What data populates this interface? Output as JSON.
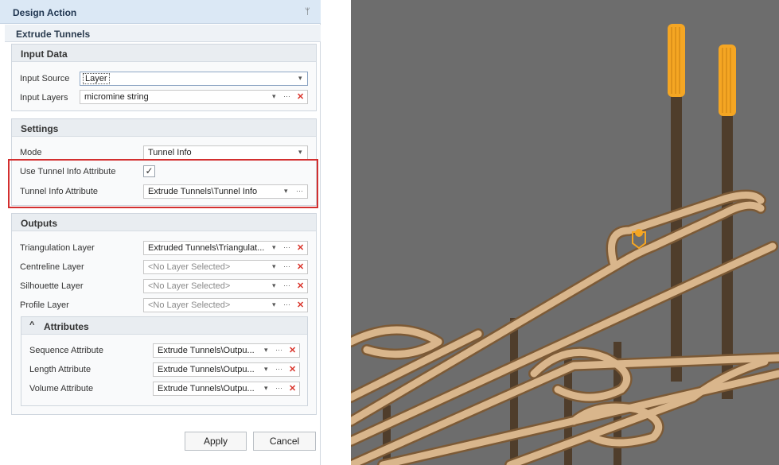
{
  "panel": {
    "title": "Design Action",
    "pin": "ᛘ",
    "subtitle": "Extrude Tunnels",
    "input_data": {
      "header": "Input Data",
      "input_source_label": "Input Source",
      "input_source_value": "Layer",
      "input_layers_label": "Input Layers",
      "input_layers_value": "micromine string"
    },
    "settings": {
      "header": "Settings",
      "mode_label": "Mode",
      "mode_value": "Tunnel Info",
      "use_attr_label": "Use Tunnel Info Attribute",
      "use_attr_checked": "✓",
      "attr_label": "Tunnel Info Attribute",
      "attr_value": "Extrude Tunnels\\Tunnel Info"
    },
    "outputs": {
      "header": "Outputs",
      "triangulation_label": "Triangulation Layer",
      "triangulation_value": "Extruded Tunnels\\Triangulat...",
      "centreline_label": "Centreline Layer",
      "centreline_value": "<No Layer Selected>",
      "silhouette_label": "Silhouette Layer",
      "silhouette_value": "<No Layer Selected>",
      "profile_label": "Profile Layer",
      "profile_value": "<No Layer Selected>",
      "attributes": {
        "header": "Attributes",
        "collapse_glyph": "^",
        "sequence_label": "Sequence Attribute",
        "sequence_value": "Extrude Tunnels\\Outpu...",
        "length_label": "Length Attribute",
        "length_value": "Extrude Tunnels\\Outpu...",
        "volume_label": "Volume Attribute",
        "volume_value": "Extrude Tunnels\\Outpu..."
      }
    },
    "apply_label": "Apply",
    "cancel_label": "Cancel",
    "glyphs": {
      "dropdown": "▾",
      "more": "···",
      "clear": "✕"
    }
  },
  "viewport": {
    "background": "#6d6d6d",
    "tunnel_color": "#d9b68c",
    "shaft_color": "#4f3d2b",
    "head_color": "#f5a623"
  }
}
